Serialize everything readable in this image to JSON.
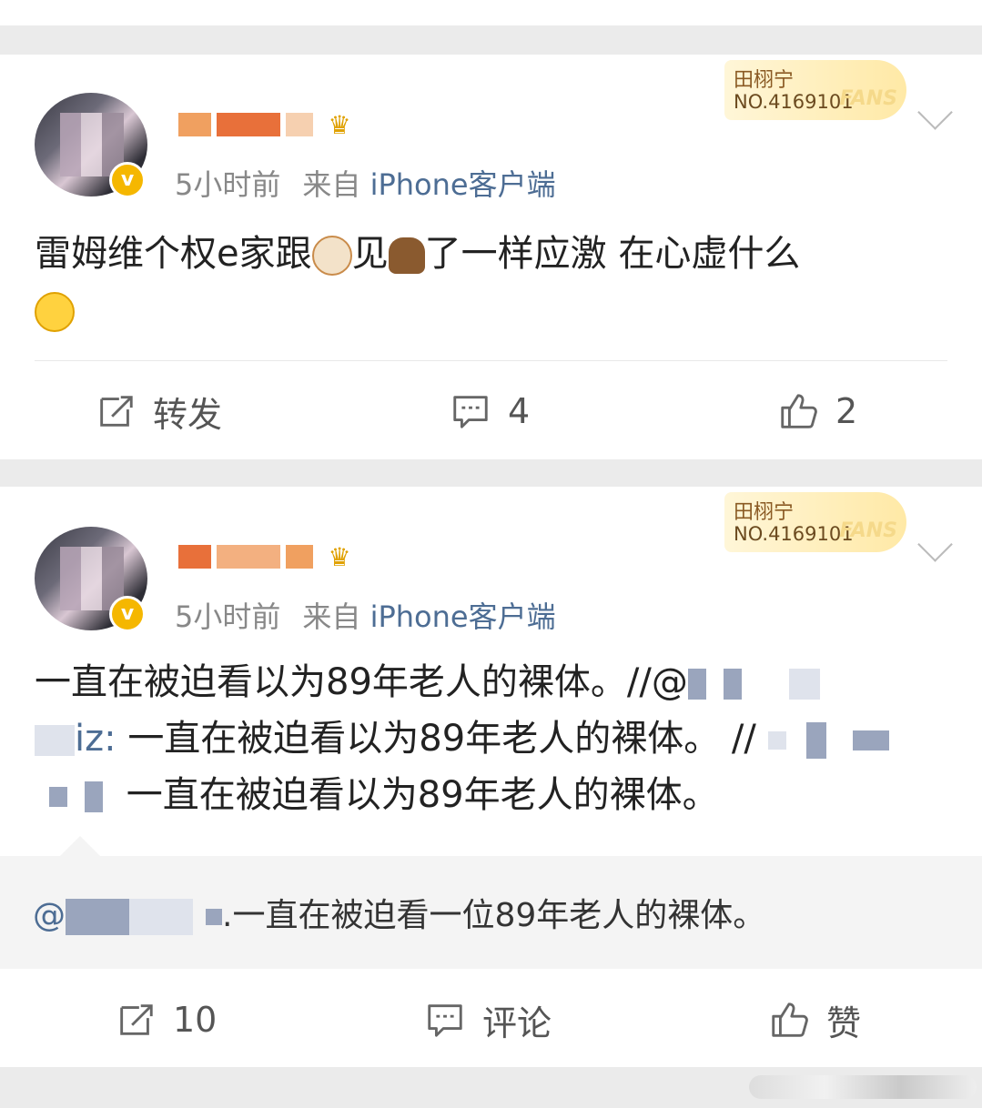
{
  "posts": [
    {
      "time": "5小时前",
      "source_prefix": "来自",
      "client": "iPhone客户端",
      "fans_badge": {
        "name": "田栩宁",
        "number": "NO.4169101",
        "tag": "FANS"
      },
      "content_text": "雷姆维个权e家跟",
      "content_mid": "见",
      "content_tail": "了一样应激 在心虚什么",
      "actions": {
        "repost": "转发",
        "comment": "4",
        "like": "2"
      }
    },
    {
      "time": "5小时前",
      "source_prefix": "来自",
      "client": "iPhone客户端",
      "fans_badge": {
        "name": "田栩宁",
        "number": "NO.4169101",
        "tag": "FANS"
      },
      "line1": "一直在被迫看以为89年老人的裸体。//@",
      "line2_prefix": "iz:",
      "line2": "一直在被迫看以为89年老人的裸体。 //",
      "line3": "一直在被迫看以为89年老人的裸体。",
      "quote_prefix": "@",
      "quote_text": ".一直在被迫看一位89年老人的裸体。",
      "actions": {
        "repost": "10",
        "comment": "评论",
        "like": "赞"
      }
    }
  ],
  "colors": {
    "link": "#4d6d94",
    "verified": "#f5b700",
    "crown": "#e0a100"
  }
}
